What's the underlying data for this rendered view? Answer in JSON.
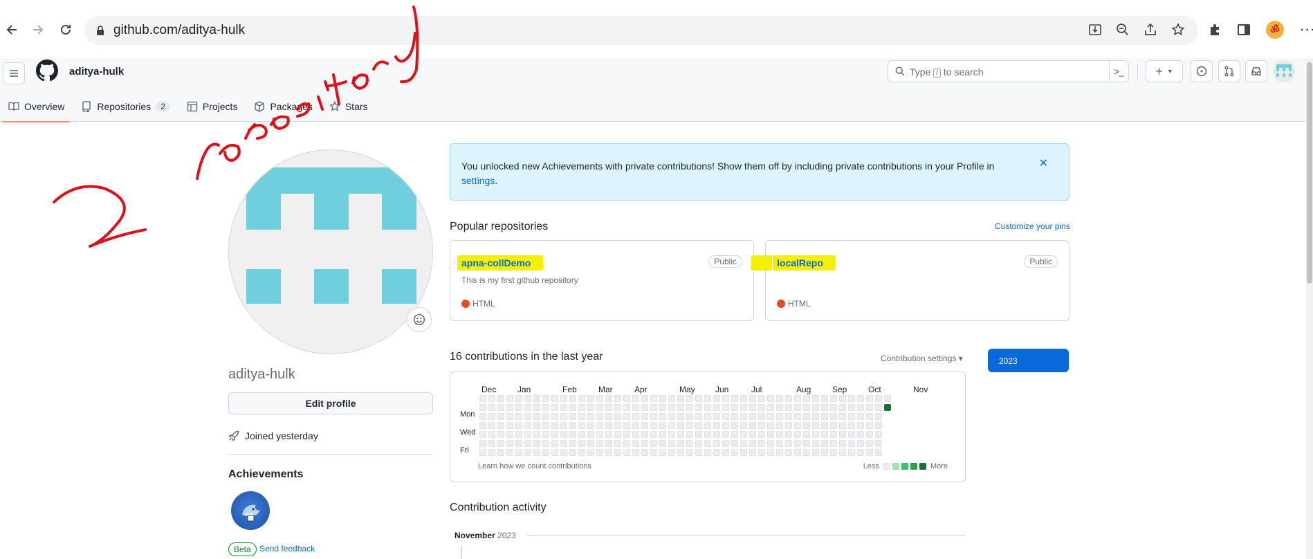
{
  "browser": {
    "url": "github.com/aditya-hulk",
    "back_icon": "arrow-left-icon",
    "forward_icon": "arrow-right-icon",
    "reload_icon": "reload-icon"
  },
  "header": {
    "username": "aditya-hulk",
    "search_placeholder_pre": "Type",
    "search_key": "/",
    "search_placeholder_post": "to search",
    "plus_label": "+",
    "terminal_label": ">_"
  },
  "tabs": [
    {
      "label": "Overview",
      "icon": "book-icon",
      "selected": true
    },
    {
      "label": "Repositories",
      "icon": "repo-icon",
      "count": "2"
    },
    {
      "label": "Projects",
      "icon": "table-icon"
    },
    {
      "label": "Packages",
      "icon": "package-icon"
    },
    {
      "label": "Stars",
      "icon": "star-icon"
    }
  ],
  "profile": {
    "name": "aditya-hulk",
    "edit_label": "Edit profile",
    "joined": "Joined yesterday",
    "achievements_title": "Achievements",
    "beta": "Beta",
    "feedback": "Send feedback"
  },
  "flash": {
    "text": "You unlocked new Achievements with private contributions! Show them off by including private contributions in your Profile in",
    "link": "settings",
    "end": "."
  },
  "popular": {
    "title": "Popular repositories",
    "customize": "Customize your pins",
    "repos": [
      {
        "name": "apna-collDemo",
        "visibility": "Public",
        "description": "This is my first github repository",
        "language": "HTML"
      },
      {
        "name": "localRepo",
        "visibility": "Public",
        "description": "",
        "language": "HTML"
      }
    ]
  },
  "contributions": {
    "title": "16 contributions in the last year",
    "settings": "Contribution settings ▾",
    "year": "2023",
    "months": [
      "Dec",
      "Jan",
      "Feb",
      "Mar",
      "Apr",
      "May",
      "Jun",
      "Jul",
      "Aug",
      "Sep",
      "Oct",
      "Nov"
    ],
    "days": [
      "Mon",
      "Wed",
      "Fri"
    ],
    "learn": "Learn how we count contributions",
    "less": "Less",
    "more": "More",
    "colors": [
      "#ebedf0",
      "#9be9a8",
      "#40c463",
      "#30a14e",
      "#216e39"
    ]
  },
  "activity": {
    "title": "Contribution activity",
    "month": "November",
    "year": "2023"
  },
  "annotation": {
    "number": "2",
    "word": "repository",
    "color": "#e0101a"
  }
}
